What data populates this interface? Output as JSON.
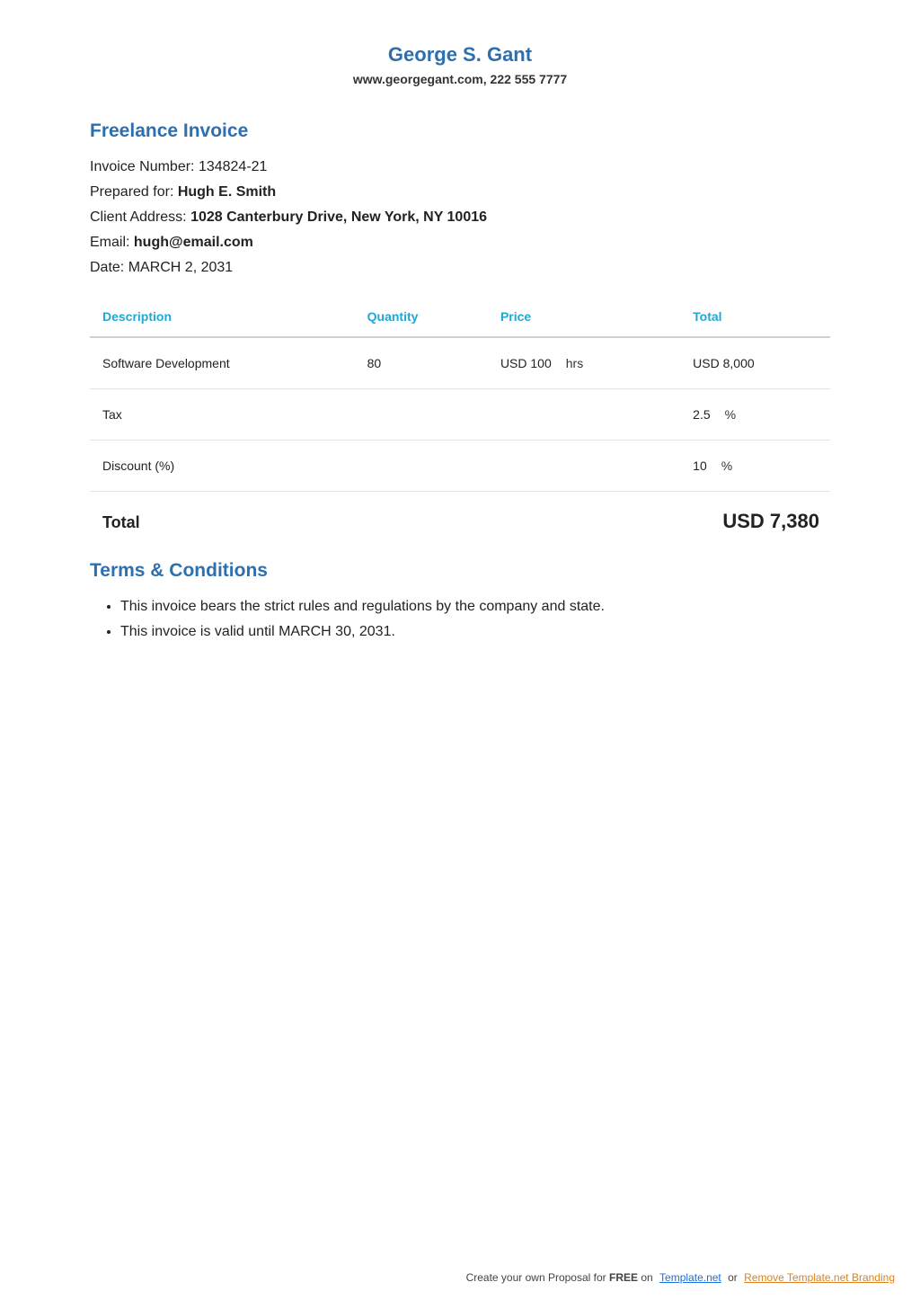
{
  "header": {
    "name": "George S. Gant",
    "contact": "www.georgegant.com, 222 555 7777"
  },
  "invoice": {
    "heading": "Freelance Invoice",
    "number_label": "Invoice Number: ",
    "number": "134824-21",
    "prepared_label": "Prepared for: ",
    "prepared_for": "Hugh E. Smith",
    "address_label": "Client Address: ",
    "address": "1028 Canterbury Drive, New York, NY 10016",
    "email_label": "Email: ",
    "email": "hugh@email.com",
    "date_label": "Date: ",
    "date": "MARCH 2, 2031"
  },
  "table": {
    "headers": {
      "description": "Description",
      "quantity": "Quantity",
      "price": "Price",
      "total": "Total"
    },
    "row_item": {
      "description": "Software Development",
      "quantity": "80",
      "price": "USD 100",
      "price_unit": "hrs",
      "total": "USD 8,000"
    },
    "row_tax": {
      "label": "Tax",
      "value": "2.5",
      "unit": "%"
    },
    "row_discount": {
      "label": "Discount (%)",
      "value": "10",
      "unit": "%"
    },
    "grand": {
      "label": "Total",
      "amount": "USD 7,380"
    }
  },
  "terms": {
    "heading": "Terms & Conditions",
    "items": [
      "This invoice bears the strict rules and regulations by the company and state.",
      "This invoice is valid until MARCH 30, 2031."
    ]
  },
  "footer": {
    "pre": "Create your own Proposal for ",
    "free": "FREE",
    "on": " on",
    "link1": "Template.net",
    "or": "  or ",
    "link2": "Remove Template.net Branding"
  }
}
